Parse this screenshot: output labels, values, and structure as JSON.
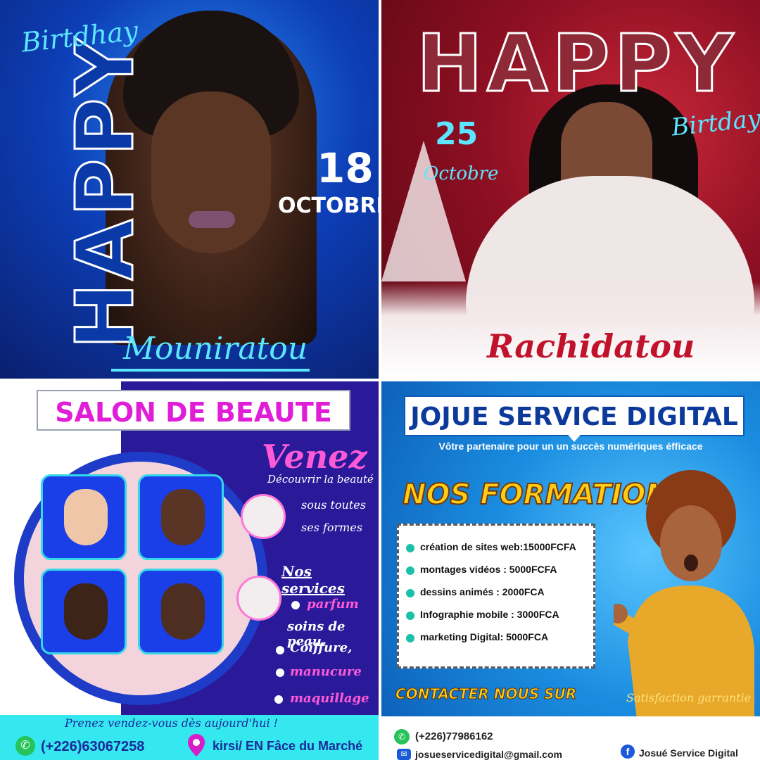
{
  "panel1": {
    "birthday": "Birtdhay",
    "happy": "HAPPY",
    "date": "18",
    "month": "OCTOBRE",
    "name": "Mouniratou"
  },
  "panel2": {
    "happy": "HAPPY",
    "date": "25",
    "month": "Octobre",
    "birthday": "Birtday",
    "name": "Rachidatou"
  },
  "panel3": {
    "title": "SALON DE BEAUTE",
    "venez": "Venez",
    "decouvrir": "Découvrir la beauté",
    "sous": "sous toutes",
    "formes": "ses formes",
    "services_title": "Nos services",
    "services": [
      "parfum",
      "soins de peau.",
      "Coiffure,",
      "manucure",
      "maquillage"
    ],
    "prenez": "Prenez vendez-vous dès aujourd'hui !",
    "phone": "(+226)63067258",
    "place": "kirsi/ EN Fâce du Marché"
  },
  "panel4": {
    "title": "JOJUE SERVICE DIGITAL",
    "tagline": "Vôtre partenaire pour un un succès numériques éfficace",
    "formations": "NOS FORMATIONS",
    "items": [
      "création de sites web:15000FCFA",
      "montages vidéos : 5000FCFA",
      "dessins animés : 2000FCA",
      "Infographie mobile : 3000FCA",
      "marketing Digital: 5000FCA"
    ],
    "contact": "CONTACTER NOUS SUR",
    "satisfaction": "Satisfaction garrantie",
    "phone": "(+226)77986162",
    "email": "josueservicedigital@gmail.com",
    "facebook": "Josué Service Digital"
  },
  "colors": {
    "cyan": "#5ce6ff",
    "magenta": "#e01ed8",
    "pink": "#ff5ad6",
    "gold": "#ffcc1a",
    "red": "#c0132b"
  },
  "icons": [
    "whatsapp-icon",
    "location-pin-icon",
    "mail-icon",
    "facebook-icon"
  ]
}
